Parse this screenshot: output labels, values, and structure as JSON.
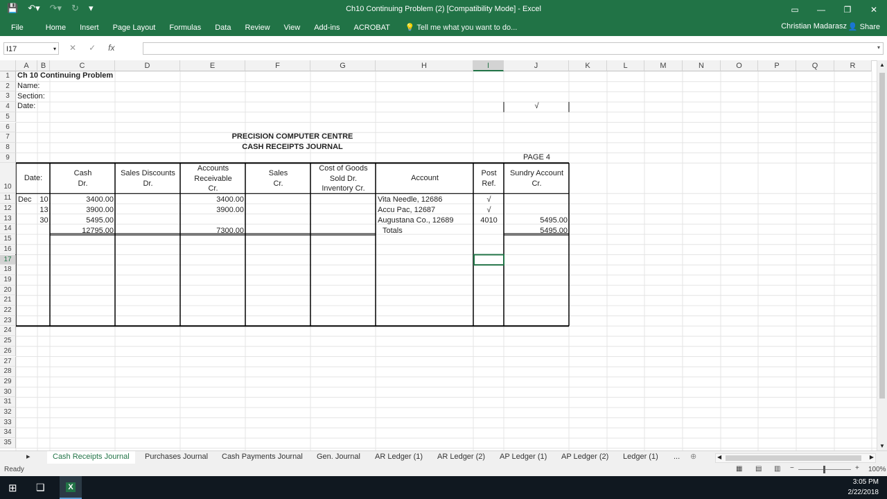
{
  "window": {
    "title": "Ch10 Continuing Problem (2)  [Compatibility Mode] - Excel",
    "user": "Christian Madarasz",
    "share": "Share"
  },
  "ribbon": {
    "tabs": [
      "File",
      "Home",
      "Insert",
      "Page Layout",
      "Formulas",
      "Data",
      "Review",
      "View",
      "Add-ins",
      "ACROBAT"
    ],
    "tell": "Tell me what you want to do..."
  },
  "formula_bar": {
    "name_box": "I17",
    "fx": "fx",
    "value": ""
  },
  "columns": [
    "A",
    "B",
    "C",
    "D",
    "E",
    "F",
    "G",
    "H",
    "I",
    "J",
    "K",
    "L",
    "M",
    "N",
    "O",
    "P",
    "Q",
    "R"
  ],
  "selected_column": "I",
  "rows": [
    1,
    2,
    3,
    4,
    5,
    6,
    7,
    8,
    9,
    10,
    11,
    12,
    13,
    14,
    15,
    16,
    17,
    18,
    19,
    20,
    21,
    22,
    23,
    24,
    25,
    26,
    27,
    28,
    29,
    30,
    31,
    32,
    33,
    34,
    35
  ],
  "selected_row": 17,
  "sheet": {
    "a1": "Ch 10 Continuing Problem",
    "a2": "Name:",
    "a3": "Section:",
    "a4": "Date:",
    "j4": "√",
    "title1": "PRECISION COMPUTER CENTRE",
    "title2": "CASH RECEIPTS JOURNAL",
    "page": "PAGE 4",
    "headers": {
      "date": "Date:",
      "cash1": "Cash",
      "cash2": "Dr.",
      "sd1": "Sales Discounts",
      "sd2": "Dr.",
      "ar1": "Accounts",
      "ar2": "Receivable",
      "ar3": "Cr.",
      "sales1": "Sales",
      "sales2": "Cr.",
      "cogs1": "Cost of Goods",
      "cogs2": "Sold  Dr.",
      "cogs3": "Inventory  Cr.",
      "account": "Account",
      "post1": "Post",
      "post2": "Ref.",
      "sundry1": "Sundry Account",
      "sundry2": "Cr."
    },
    "entries": [
      {
        "month": "Dec",
        "day": "10",
        "cash": "3400.00",
        "ar": "3400.00",
        "account": "Vita Needle, 12686",
        "ref": "√",
        "sundry": ""
      },
      {
        "month": "",
        "day": "13",
        "cash": "3900.00",
        "ar": "3900.00",
        "account": "Accu Pac, 12687",
        "ref": "√",
        "sundry": ""
      },
      {
        "month": "",
        "day": "30",
        "cash": "5495.00",
        "ar": "",
        "account": "Augustana Co., 12689",
        "ref": "4010",
        "sundry": "5495.00"
      }
    ],
    "totals": {
      "cash": "12795.00",
      "ar": "7300.00",
      "label": "Totals",
      "sundry": "5495.00"
    }
  },
  "sheet_tabs": [
    "Cash Receipts Journal",
    "Purchases Journal",
    "Cash Payments Journal",
    "Gen. Journal",
    "AR Ledger (1)",
    "AR Ledger (2)",
    "AP Ledger (1)",
    "AP Ledger (2)",
    "Ledger (1)",
    "..."
  ],
  "status": {
    "ready": "Ready",
    "zoom": "100%"
  },
  "taskbar": {
    "time": "3:05 PM",
    "date": "2/22/2018"
  }
}
